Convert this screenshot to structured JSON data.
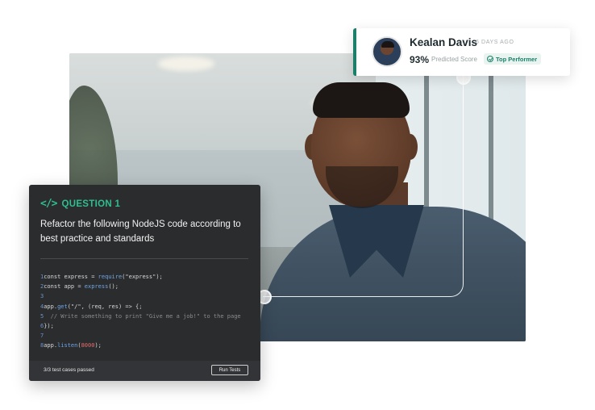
{
  "profile": {
    "name": "Kealan Davis",
    "time_ago": "6 DAYS AGO",
    "score": "93%",
    "score_label": "Predicted Score",
    "badge": "Top Performer",
    "accent_color": "#1b7f69"
  },
  "question": {
    "icon": "</>",
    "title": "QUESTION 1",
    "prompt": "Refactor the following NodeJS code according to best practice and standards",
    "code_lines": [
      "const express = require(\"express\");",
      "const app = express();",
      "",
      "app.get(\"/\", (req, res) => {;",
      "  // Write something to print \"Give me a job!\" to the page",
      "});",
      "",
      "app.listen(8000);"
    ],
    "status": "3/3 test cases passed",
    "run_button": "Run Tests"
  },
  "icons": {
    "code": "code-brackets-icon",
    "check": "check-circle-icon"
  }
}
